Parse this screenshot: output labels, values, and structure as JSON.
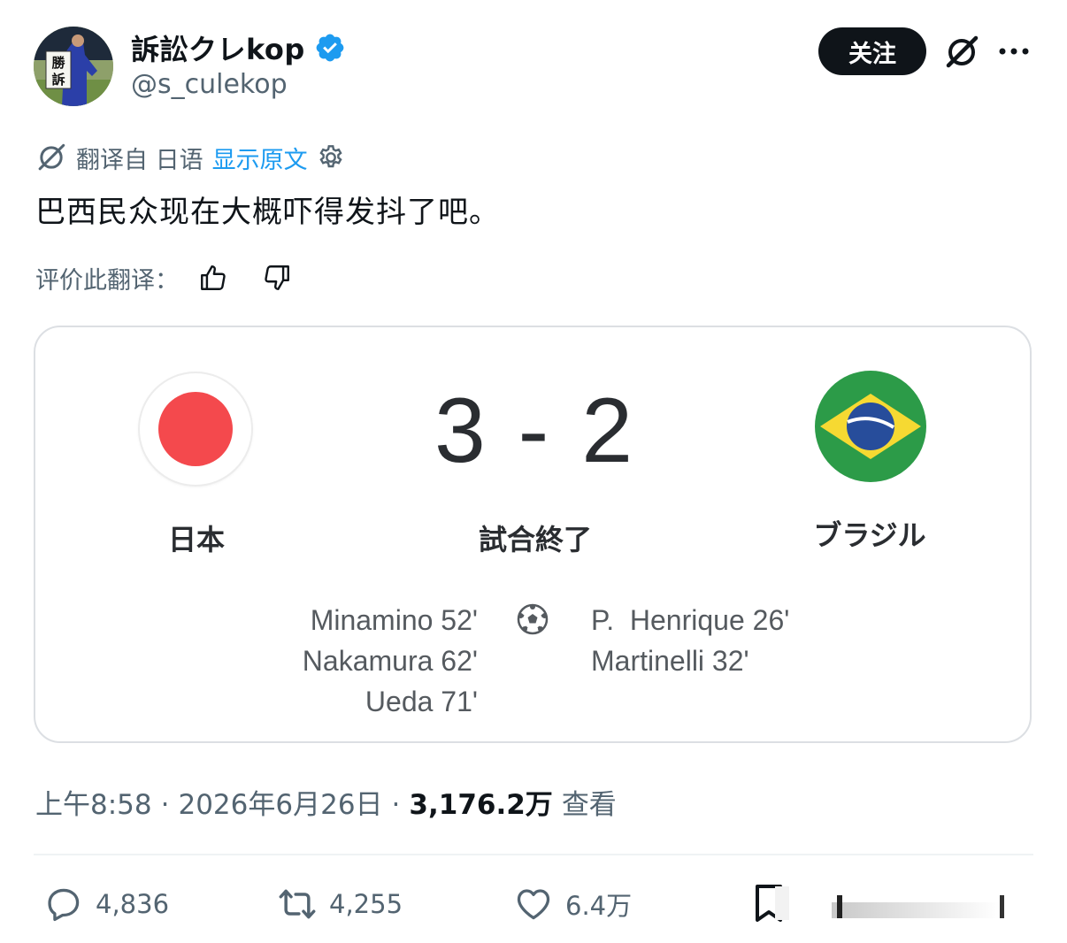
{
  "header": {
    "display_name": "訴訟クレkop",
    "handle": "@s_culekop",
    "avatar_sign_text": "勝訴",
    "follow_label": "关注",
    "icons": [
      "verified-badge-icon",
      "grok-icon",
      "more-icon"
    ]
  },
  "translation": {
    "label": "翻译自 日语",
    "show_original": "显示原文",
    "icons": [
      "translate-icon",
      "settings-gear-icon"
    ]
  },
  "tweet_text": "巴西民众现在大概吓得发抖了吧。",
  "rate": {
    "label": "评价此翻译：",
    "icons": [
      "thumbs-up-icon",
      "thumbs-down-icon"
    ]
  },
  "scorecard": {
    "home_team": "日本",
    "away_team": "ブラジル",
    "score": "3 - 2",
    "status": "試合終了",
    "home_scorers": [
      "Minamino 52'",
      "Nakamura 62'",
      "Ueda 71'"
    ],
    "away_scorers": [
      "P.  Henrique 26'",
      "Martinelli 32'"
    ],
    "home_flag_color": "#f4494d",
    "away_flag_colors": {
      "green": "#2c9b48",
      "yellow": "#f6d932",
      "blue": "#274d9b"
    }
  },
  "meta": {
    "time": "上午8:58",
    "separator": "·",
    "date": "2026年6月26日",
    "views_count": "3,176.2万",
    "views_label": "查看"
  },
  "actions": {
    "replies": "4,836",
    "retweets": "4,255",
    "likes": "6.4万"
  },
  "colors": {
    "accent": "#1d9bf0",
    "text": "#0f1419",
    "muted": "#536471"
  }
}
